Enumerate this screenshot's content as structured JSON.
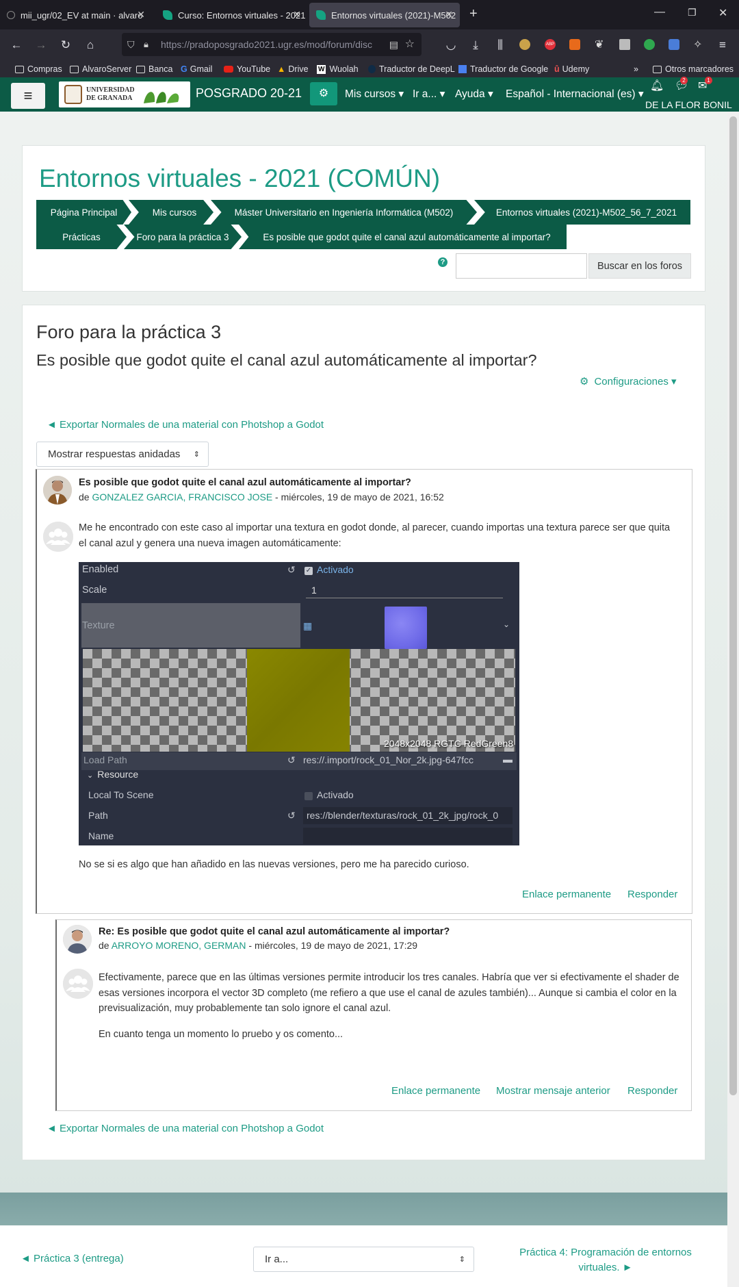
{
  "browser": {
    "tabs": [
      {
        "title": "mii_ugr/02_EV at main · alvaro"
      },
      {
        "title": "Curso: Entornos virtuales - 2021"
      },
      {
        "title": "Entornos virtuales (2021)-M502"
      }
    ],
    "url": "https://pradoposgrado2021.ugr.es/mod/forum/disc",
    "bookmarks": [
      "Compras",
      "AlvaroServer",
      "Banca",
      "Gmail",
      "YouTube",
      "Drive",
      "Wuolah",
      "Traductor de DeepL",
      "Traductor de Google",
      "Udemy"
    ],
    "other_bookmarks": "Otros marcadores"
  },
  "navbar": {
    "brand": "POSGRADO 20-21",
    "logo_text_line1": "UNIVERSIDAD",
    "logo_text_line2": "DE GRANADA",
    "menu": [
      "Mis cursos",
      "Ir a...",
      "Ayuda",
      "Español - Internacional (es)"
    ],
    "user": "DE LA FLOR BONIL",
    "notif_count": "1",
    "msg_count": "2",
    "mail_count": "1"
  },
  "header": {
    "course_title": "Entornos virtuales - 2021 (COMÚN)",
    "breadcrumbs": [
      "Página Principal",
      "Mis cursos",
      "Máster Universitario en Ingeniería Informática (M502)",
      "Entornos virtuales (2021)-M502_56_7_2021",
      "Prácticas",
      "Foro para la práctica 3",
      "Es posible que godot quite el canal azul automáticamente al importar?"
    ],
    "search_button": "Buscar en los foros",
    "help_symbol": "?"
  },
  "main": {
    "forum_title": "Foro para la práctica 3",
    "discussion_title": "Es posible que godot quite el canal azul automáticamente al importar?",
    "settings": "Configuraciones",
    "prev_discussion": "◄ Exportar Normales de una material con Photshop a Godot",
    "display_mode": "Mostrar respuestas anidadas"
  },
  "post1": {
    "subject": "Es posible que godot quite el canal azul automáticamente al importar?",
    "by_prefix": "de ",
    "author": "GONZALEZ GARCIA, FRANCISCO JOSE",
    "date": " - miércoles, 19 de mayo de 2021, 16:52",
    "body": "Me he encontrado con este caso al importar una textura en godot donde, al parecer, cuando importas una textura parece ser que quita el canal azul y genera una nueva imagen automáticamente:",
    "footer_text": "No se si es algo que han añadido en las nuevas versiones, pero me ha parecido curioso.",
    "permalink": "Enlace permanente",
    "reply": "Responder"
  },
  "godot_inspector": {
    "enabled_label": "Enabled",
    "enabled_value": "Activado",
    "scale_label": "Scale",
    "scale_value": "1",
    "texture_label": "Texture",
    "texture_info": "2048x2048 RGTC RedGreen8",
    "load_path_label": "Load Path",
    "load_path_value": "res://.import/rock_01_Nor_2k.jpg-647fcc",
    "resource_label": "Resource",
    "local_to_scene_label": "Local To Scene",
    "local_to_scene_value": "Activado",
    "path_label": "Path",
    "path_value": "res://blender/texturas/rock_01_2k_jpg/rock_0",
    "name_label": "Name"
  },
  "post2": {
    "subject": "Re: Es posible que godot quite el canal azul automáticamente al importar?",
    "by_prefix": "de ",
    "author": "ARROYO MORENO, GERMAN",
    "date": " - miércoles, 19 de mayo de 2021, 17:29",
    "body1": "Efectivamente, parece que en las últimas versiones permite introducir los tres canales. Habría que ver si efectivamente el shader de esas versiones incorpora el vector 3D completo (me refiero a que use el canal de azules también)... Aunque si cambia el color en la previsualización, muy probablemente tan solo ignore el canal azul.",
    "body2": "En cuanto tenga un momento lo pruebo y os comento...",
    "permalink": "Enlace permanente",
    "show_parent": "Mostrar mensaje anterior",
    "reply": "Responder"
  },
  "bottom": {
    "prev_discussion": "◄ Exportar Normales de una material con Photshop a Godot"
  },
  "footer": {
    "prev_activity": "◄ Práctica 3 (entrega)",
    "goto_select": "Ir a...",
    "next_activity_line1": "Práctica 4: Programación de entornos",
    "next_activity_line2": "virtuales. ►"
  }
}
